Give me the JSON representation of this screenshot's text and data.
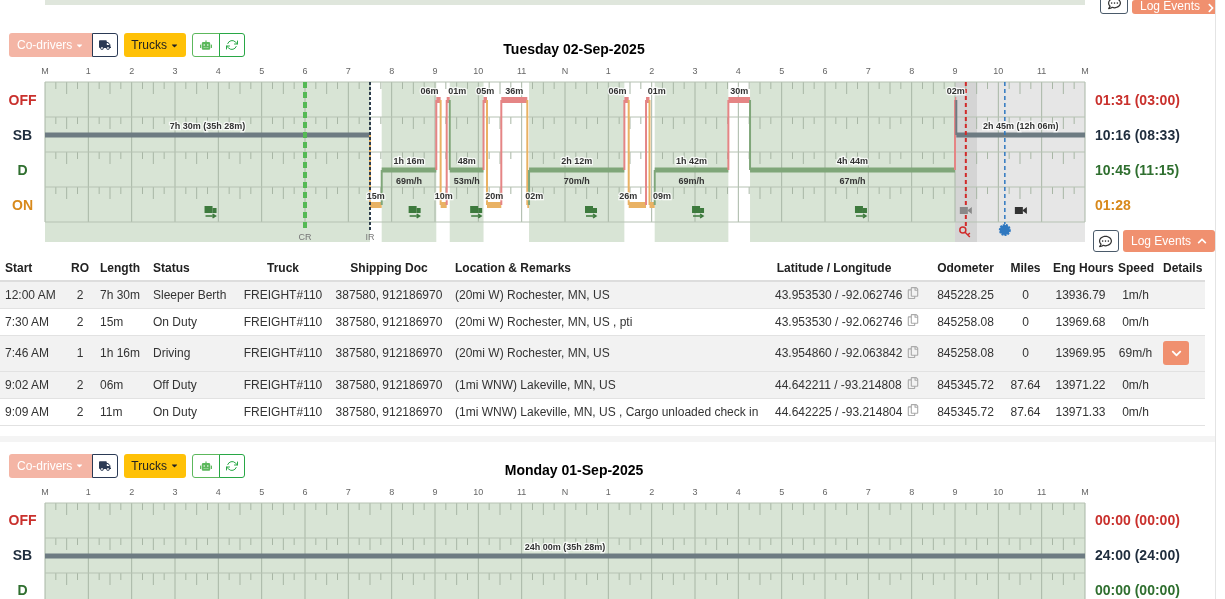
{
  "previous_day": {
    "log_events_button": "Log Events",
    "expanded": false
  },
  "days": [
    {
      "title": "Tuesday 02-Sep-2025",
      "codrivers": "Co-drivers",
      "trucks": "Trucks",
      "hours": [
        "M",
        "1",
        "2",
        "3",
        "4",
        "5",
        "6",
        "7",
        "8",
        "9",
        "10",
        "11",
        "N",
        "1",
        "2",
        "3",
        "4",
        "5",
        "6",
        "7",
        "8",
        "9",
        "10",
        "11",
        "M"
      ],
      "rows": [
        {
          "kind": "off",
          "label": "OFF",
          "total": "01:31 (03:00)"
        },
        {
          "kind": "sb",
          "label": "SB",
          "total": "10:16 (08:33)"
        },
        {
          "kind": "d",
          "label": "D",
          "total": "10:45 (11:15)"
        },
        {
          "kind": "on",
          "label": "ON",
          "total": "01:28"
        }
      ],
      "segments": [
        {
          "kind": "sb",
          "label": "7h 30m (35h 28m)"
        },
        {
          "kind": "on",
          "label": "15m"
        },
        {
          "kind": "d",
          "label": "1h 16m",
          "speed": "69m/h"
        },
        {
          "kind": "off",
          "label": "06m"
        },
        {
          "kind": "on",
          "label": "10m"
        },
        {
          "kind": "off",
          "label": "01m"
        },
        {
          "kind": "d",
          "label": "48m",
          "speed": "53m/h"
        },
        {
          "kind": "off",
          "label": "05m"
        },
        {
          "kind": "on",
          "label": "20m"
        },
        {
          "kind": "off",
          "label": "36m"
        },
        {
          "kind": "on",
          "label": "02m"
        },
        {
          "kind": "d",
          "label": "2h 12m",
          "speed": "70m/h"
        },
        {
          "kind": "off",
          "label": "06m"
        },
        {
          "kind": "on",
          "label": "26m"
        },
        {
          "kind": "off",
          "label": "01m"
        },
        {
          "kind": "on",
          "label": "09m"
        },
        {
          "kind": "d",
          "label": "1h 42m",
          "speed": "69m/h"
        },
        {
          "kind": "off",
          "label": "30m"
        },
        {
          "kind": "d",
          "label": "4h 44m",
          "speed": "67m/h"
        },
        {
          "kind": "off",
          "label": "02m"
        },
        {
          "kind": "sb",
          "label": "2h 45m (12h 06m)"
        }
      ],
      "markers": [
        {
          "kind": "cycle",
          "label": "CR"
        },
        {
          "kind": "reset",
          "label": "IR"
        }
      ],
      "log_events_button": "Log Events",
      "expanded": true,
      "table": {
        "columns": [
          "Start",
          "RO",
          "Length",
          "Status",
          "Truck",
          "Shipping Doc",
          "Location & Remarks",
          "Latitude / Longitude",
          "Odometer",
          "Miles",
          "Eng Hours",
          "Speed",
          "Details"
        ],
        "rows": [
          {
            "shaded": true,
            "has_details": false,
            "cells": [
              "12:00 AM",
              "2",
              "7h 30m",
              "Sleeper Berth",
              "FREIGHT#110",
              "387580, 912186970",
              "(20mi W) Rochester, MN, US",
              "43.953530 / -92.062746",
              "845228.25",
              "0",
              "13936.79",
              "1m/h"
            ]
          },
          {
            "shaded": false,
            "has_details": false,
            "cells": [
              "7:30 AM",
              "2",
              "15m",
              "On Duty",
              "FREIGHT#110",
              "387580, 912186970",
              "(20mi W) Rochester, MN, US , pti",
              "43.953530 / -92.062746",
              "845258.08",
              "0",
              "13969.68",
              "0m/h"
            ]
          },
          {
            "shaded": true,
            "has_details": true,
            "cells": [
              "7:46 AM",
              "1",
              "1h 16m",
              "Driving",
              "FREIGHT#110",
              "387580, 912186970",
              "(20mi W) Rochester, MN, US",
              "43.954860 / -92.063842",
              "845258.08",
              "0",
              "13969.95",
              "69m/h"
            ]
          },
          {
            "shaded": true,
            "has_details": false,
            "cells": [
              "9:02 AM",
              "2",
              "06m",
              "Off Duty",
              "FREIGHT#110",
              "387580, 912186970",
              "(1mi WNW) Lakeville, MN, US",
              "44.642211 / -93.214808",
              "845345.72",
              "87.64",
              "13971.22",
              "0m/h"
            ]
          },
          {
            "shaded": false,
            "has_details": false,
            "cells": [
              "9:09 AM",
              "2",
              "11m",
              "On Duty",
              "FREIGHT#110",
              "387580, 912186970",
              "(1mi WNW) Lakeville, MN, US , Cargo unloaded check in",
              "44.642225 / -93.214804",
              "845345.72",
              "87.64",
              "13971.33",
              "0m/h"
            ]
          }
        ]
      }
    },
    {
      "title": "Monday 01-Sep-2025",
      "codrivers": "Co-drivers",
      "trucks": "Trucks",
      "hours": [
        "M",
        "1",
        "2",
        "3",
        "4",
        "5",
        "6",
        "7",
        "8",
        "9",
        "10",
        "11",
        "N",
        "1",
        "2",
        "3",
        "4",
        "5",
        "6",
        "7",
        "8",
        "9",
        "10",
        "11",
        "M"
      ],
      "rows": [
        {
          "kind": "off",
          "label": "OFF",
          "total": "00:00 (00:00)"
        },
        {
          "kind": "sb",
          "label": "SB",
          "total": "24:00 (24:00)"
        },
        {
          "kind": "d",
          "label": "D",
          "total": "00:00 (00:00)"
        }
      ],
      "segments": [
        {
          "kind": "sb",
          "label": "24h 00m (35h 28m)"
        }
      ]
    }
  ]
}
